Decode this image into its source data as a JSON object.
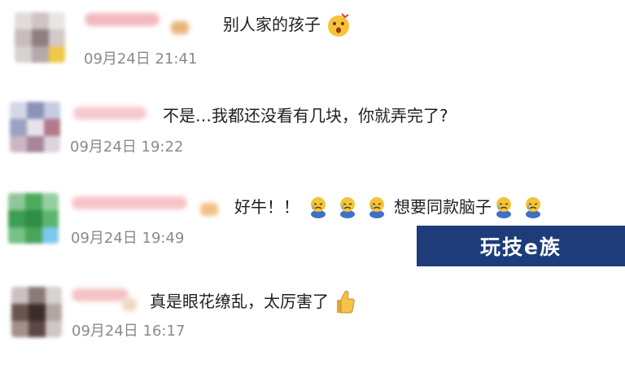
{
  "comments": [
    {
      "text": "别人家的孩子",
      "time": "09月24日 21:41",
      "emojis": [
        "surprised-emoji"
      ]
    },
    {
      "text": "不是…我都还没看有几块，你就弄完了?",
      "time": "09月24日 19:22",
      "emojis": []
    },
    {
      "text_part1": "好牛！！",
      "text_part2": "想要同款脑子",
      "time": "09月24日 19:49",
      "emojis": [
        "crying-emoji",
        "crying-emoji",
        "crying-emoji",
        "crying-emoji",
        "crying-emoji"
      ]
    },
    {
      "text": "真是眼花缭乱，太厉害了",
      "time": "09月24日 16:17",
      "emojis": [
        "thumbs-up-emoji"
      ]
    }
  ],
  "watermark": {
    "text": "玩技e族"
  },
  "colors": {
    "comment_text": "#1f1f1f",
    "timestamp": "#8a8a8a",
    "watermark_bg": "#1e3c7a",
    "watermark_text": "#ffffff"
  }
}
